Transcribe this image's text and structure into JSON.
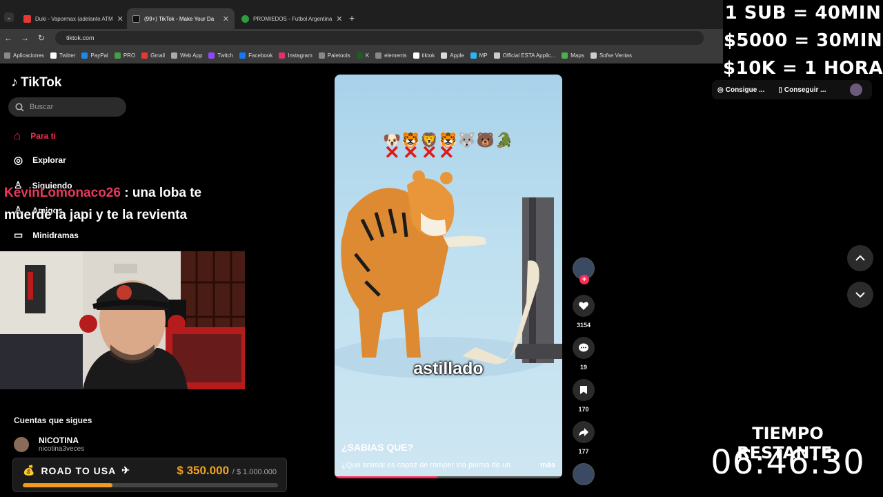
{
  "browser": {
    "tabs": [
      {
        "label": "Duki - Vapormax (adelanto ATM",
        "color": "#e53935"
      },
      {
        "label": "(99+) TikTok - Make Your Da",
        "color": "#111111"
      },
      {
        "label": "PROMIEDOS - Futbol Argentina",
        "color": "#2e9e3c"
      }
    ],
    "url": "tiktok.com",
    "bookmarks": [
      "Aplicaciones",
      "Twitter",
      "PayPal",
      "PRO",
      "Gmail",
      "Web App",
      "Twitch",
      "Facebook",
      "Instagram",
      "Paletools",
      "K",
      "elements",
      "tiktok",
      "Apple",
      "MP",
      "Official ESTA Applic...",
      "Maps",
      "Sofse Ventas"
    ]
  },
  "overlay": {
    "line1": "1 SUB = 40MIN",
    "line2": "$5000 = 30MIN",
    "line3": "$10K = 1 HORA",
    "chips": [
      "Consigue ...",
      "Conseguir ..."
    ],
    "timer_label": "TIEMPO RESTANTE:",
    "timer_value": "06:46:30"
  },
  "sidebar": {
    "logo": "TikTok",
    "search_placeholder": "Buscar",
    "nav": [
      "Para ti",
      "Explorar",
      "Siguiendo",
      "Amigos",
      "Minidramas"
    ],
    "following_title": "Cuentas que sigues",
    "account": {
      "name": "NICOTINA",
      "handle": "nicotina3veces"
    }
  },
  "chat": {
    "user": "KevinLomonaco26",
    "message": ": una loba te muerde la japi y te la revienta"
  },
  "goal": {
    "title": "ROAD TO USA",
    "amount": "$ 350.000",
    "total": "/ $ 1.000.000",
    "progress": 0.35
  },
  "video": {
    "emojis": "🐶🐯🦁🐯🐺🐻🐊",
    "caption_word": "astillado",
    "title": "¿SABIAS QUE?",
    "description": "¿Que animal es capaz de romper ina pierna de un",
    "more": "más",
    "progress": 0.45
  },
  "actions": {
    "likes": "3154",
    "comments": "19",
    "saves": "170",
    "shares": "177"
  }
}
